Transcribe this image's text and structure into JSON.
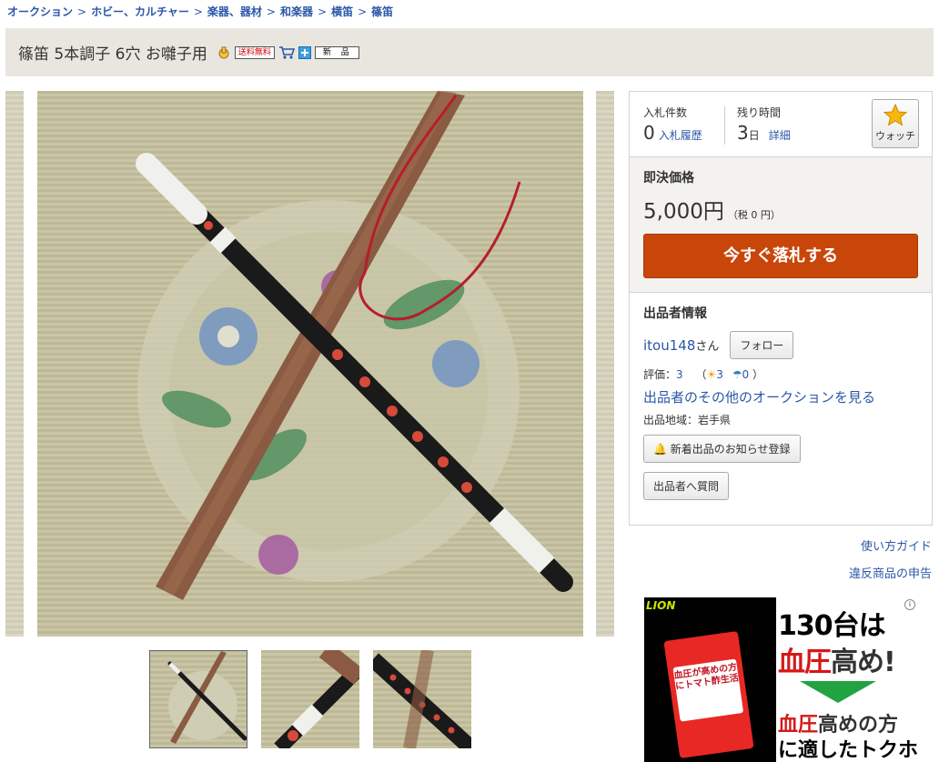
{
  "breadcrumb": [
    {
      "label": "オークション"
    },
    {
      "label": "ホビー、カルチャー"
    },
    {
      "label": "楽器、器材"
    },
    {
      "label": "和楽器"
    },
    {
      "label": "横笛"
    },
    {
      "label": "篠笛"
    }
  ],
  "breadcrumb_sep": ">",
  "title": "篠笛 5本調子 6穴 お囃子用",
  "badges": {
    "free_shipping": "送料無料",
    "new": "新 品"
  },
  "bid": {
    "count_label": "入札件数",
    "count_value": "0",
    "history_link": "入札履歴",
    "time_label": "残り時間",
    "time_value": "3",
    "time_unit": "日",
    "detail_link": "詳細",
    "watch_label": "ウォッチ"
  },
  "buy_now": {
    "label": "即決価格",
    "price": "5,000円",
    "tax": "（税 0 円）",
    "button": "今すぐ落札する"
  },
  "seller": {
    "section_title": "出品者情報",
    "name": "itou148",
    "honorific": "さん",
    "follow_button": "フォロー",
    "rating_label": "評価：",
    "rating_value": "3",
    "good_value": "3",
    "bad_value": "0",
    "other_auctions_link": "出品者のその他のオークションを見る",
    "region": "出品地域：岩手県",
    "notify_button": "新着出品のお知らせ登録",
    "question_button": "出品者へ質問"
  },
  "links": {
    "guide": "使い方ガイド",
    "report": "違反商品の申告"
  },
  "ad": {
    "brand": "LION",
    "line1": "130台は",
    "line2_red": "血圧",
    "line2_black": "高め!",
    "line3_red": "血圧",
    "line3_black": "高めの方",
    "line4": "に適したトクホ",
    "pack_text": "血圧が高めの方にトマト酢生活"
  },
  "colors": {
    "link": "#2b57a8",
    "buy_button": "#c9460b",
    "title_bg": "#e8e6df"
  }
}
